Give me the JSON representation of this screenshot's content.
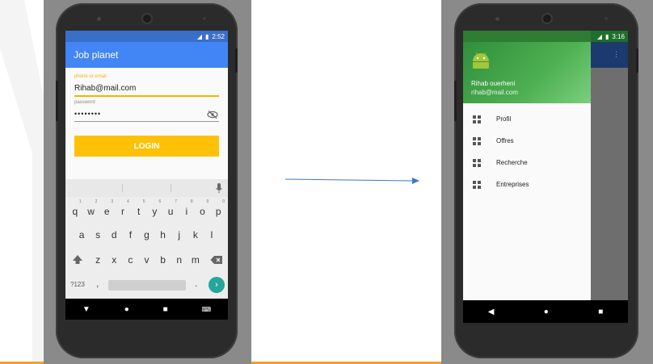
{
  "left_phone": {
    "status_time": "2:52",
    "app_title": "Job planet",
    "form": {
      "phone_label": "phone or email",
      "phone_value": "Rihab@mail.com",
      "password_label": "password",
      "password_value": "••••••••",
      "login_label": "LOGIN"
    },
    "keyboard": {
      "row1": [
        "q",
        "w",
        "e",
        "r",
        "t",
        "y",
        "u",
        "i",
        "o",
        "p"
      ],
      "row1_hints": [
        "1",
        "2",
        "3",
        "4",
        "5",
        "6",
        "7",
        "8",
        "9",
        "0"
      ],
      "row2": [
        "a",
        "s",
        "d",
        "f",
        "g",
        "h",
        "j",
        "k",
        "l"
      ],
      "row3": [
        "z",
        "x",
        "c",
        "v",
        "b",
        "n",
        "m"
      ],
      "symbols_label": "?123",
      "comma": ",",
      "period": "."
    }
  },
  "right_phone": {
    "status_time": "3:16",
    "drawer": {
      "user_name": "Rihab ouerheni",
      "user_email": "rihab@mail.com",
      "items": [
        {
          "label": "Profil",
          "icon": "grid-icon"
        },
        {
          "label": "Offres",
          "icon": "grid-icon"
        },
        {
          "label": "Recherche",
          "icon": "grid-icon"
        },
        {
          "label": "Entreprises",
          "icon": "grid-icon"
        }
      ]
    }
  },
  "colors": {
    "app_bar": "#4285f4",
    "login_button": "#ffc107",
    "drawer_header": "#4caf50",
    "arrow": "#3a78c4",
    "enter_key": "#26a69a"
  }
}
